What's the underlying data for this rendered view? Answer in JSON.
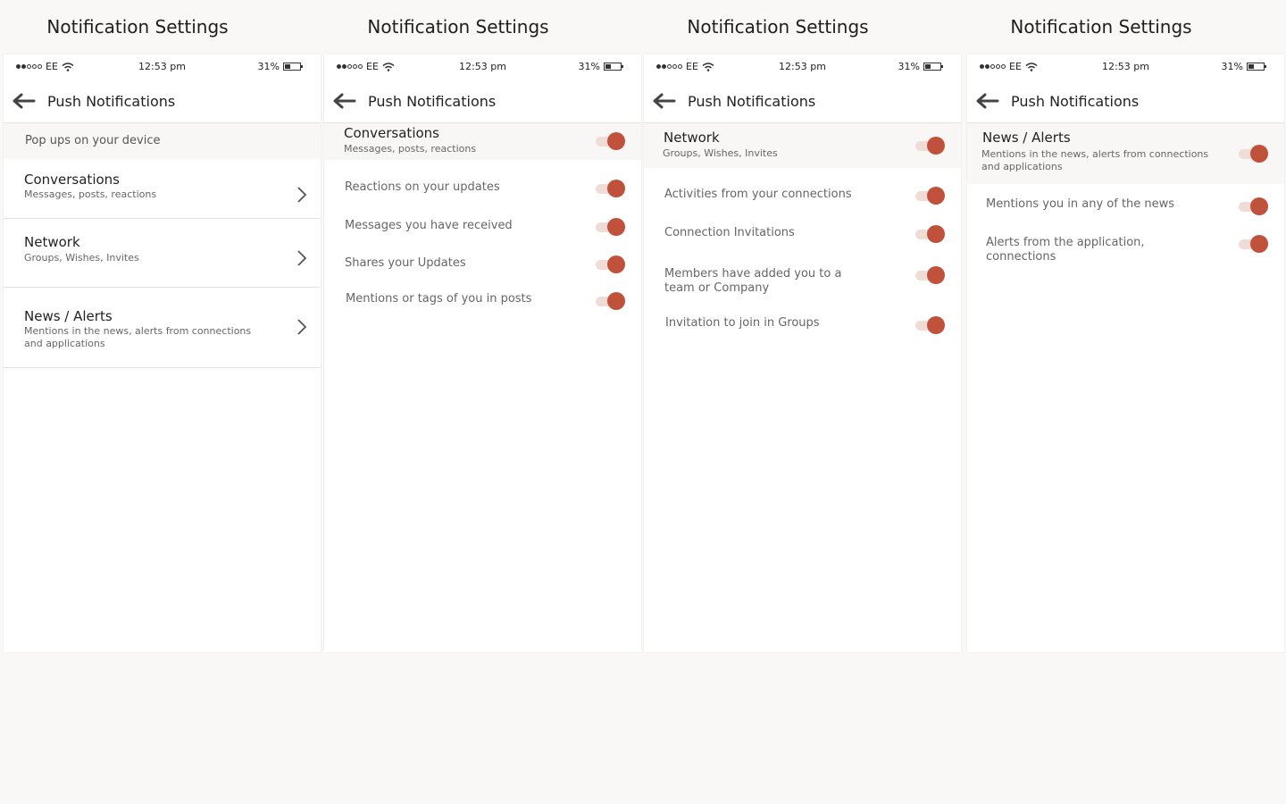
{
  "accent_color": "#c0513b",
  "section_titles": [
    "Notification Settings",
    "Notification Settings",
    "Notification Settings",
    "Notification Settings"
  ],
  "statusbar": {
    "carrier": "EE",
    "time": "12:53 pm",
    "battery": "31%"
  },
  "nav": {
    "title": "Push Notifications",
    "back_icon": "arrow-left-icon"
  },
  "screen1": {
    "subheader": "Pop ups on your device",
    "rows": [
      {
        "title": "Conversations",
        "subtitle": "Messages, posts, reactions"
      },
      {
        "title": "Network",
        "subtitle": "Groups, Wishes, Invites"
      },
      {
        "title": "News / Alerts",
        "subtitle": "Mentions in the news, alerts from connections and applications"
      }
    ]
  },
  "screen2": {
    "group_title": "Conversations",
    "group_subtitle": "Messages, posts, reactions",
    "group_on": true,
    "items": [
      {
        "label": "Reactions on your updates",
        "on": true
      },
      {
        "label": "Messages you have received",
        "on": true
      },
      {
        "label": "Shares your Updates",
        "on": true
      },
      {
        "label": "Mentions or tags of you in posts",
        "on": true
      }
    ]
  },
  "screen3": {
    "group_title": "Network",
    "group_subtitle": "Groups, Wishes, Invites",
    "group_on": true,
    "items": [
      {
        "label": "Activities from your connections",
        "on": true
      },
      {
        "label": "Connection Invitations",
        "on": true
      },
      {
        "label": "Members have added you to a team or Company",
        "on": true
      },
      {
        "label": "Invitation to join in Groups",
        "on": true
      }
    ]
  },
  "screen4": {
    "group_title": "News / Alerts",
    "group_subtitle": "Mentions in the news, alerts from connections and applications",
    "group_on": true,
    "items": [
      {
        "label": "Mentions you in any of the news",
        "on": true
      },
      {
        "label": "Alerts from the application, connections",
        "on": true
      }
    ]
  }
}
